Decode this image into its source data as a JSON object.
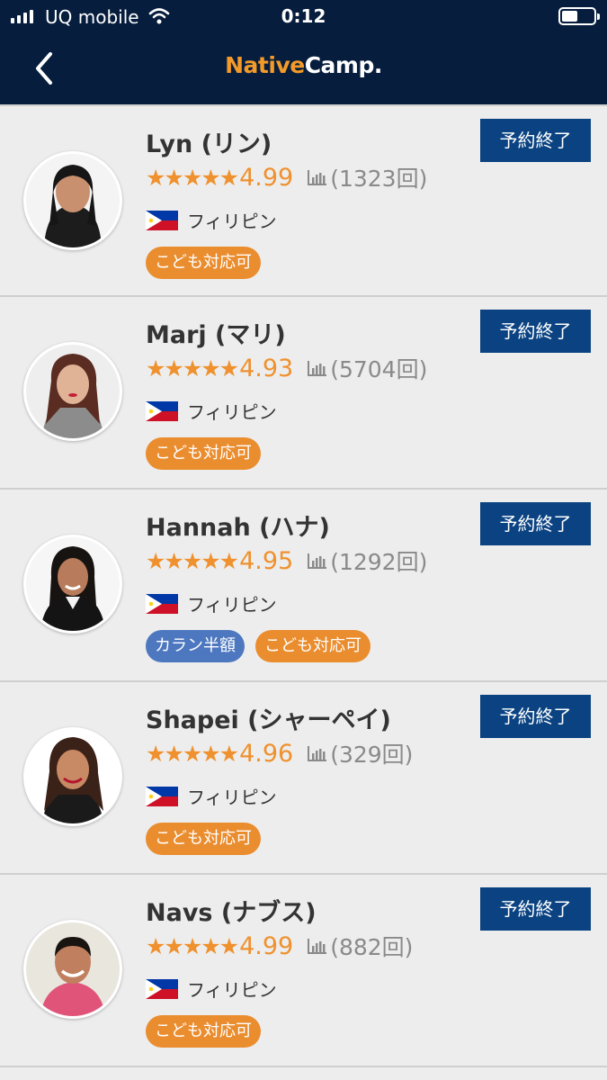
{
  "status_bar": {
    "carrier": "UQ mobile",
    "time": "0:12"
  },
  "header": {
    "logo_part1": "Native",
    "logo_part2": "Camp."
  },
  "colors": {
    "nav_background": "#061d3d",
    "brand_orange": "#f39a28",
    "star": "#ef912e",
    "button_blue": "#0b4382",
    "tag_orange": "#ea8d2f",
    "tag_blue": "#4d78c0"
  },
  "teachers": [
    {
      "name": "Lyn (リン)",
      "stars": "★★★★★",
      "rating": "4.99",
      "lesson_count": "(1323回)",
      "country": "フィリピン",
      "tags": [
        "こども対応可"
      ],
      "button": "予約終了"
    },
    {
      "name": "Marj (マリ)",
      "stars": "★★★★★",
      "rating": "4.93",
      "lesson_count": "(5704回)",
      "country": "フィリピン",
      "tags": [
        "こども対応可"
      ],
      "button": "予約終了"
    },
    {
      "name": "Hannah (ハナ)",
      "stars": "★★★★★",
      "rating": "4.95",
      "lesson_count": "(1292回)",
      "country": "フィリピン",
      "tags": [
        "カラン半額",
        "こども対応可"
      ],
      "button": "予約終了"
    },
    {
      "name": "Shapei (シャーペイ)",
      "stars": "★★★★★",
      "rating": "4.96",
      "lesson_count": "(329回)",
      "country": "フィリピン",
      "tags": [
        "こども対応可"
      ],
      "button": "予約終了"
    },
    {
      "name": "Navs (ナブス)",
      "stars": "★★★★★",
      "rating": "4.99",
      "lesson_count": "(882回)",
      "country": "フィリピン",
      "tags": [
        "こども対応可"
      ],
      "button": "予約終了"
    }
  ]
}
